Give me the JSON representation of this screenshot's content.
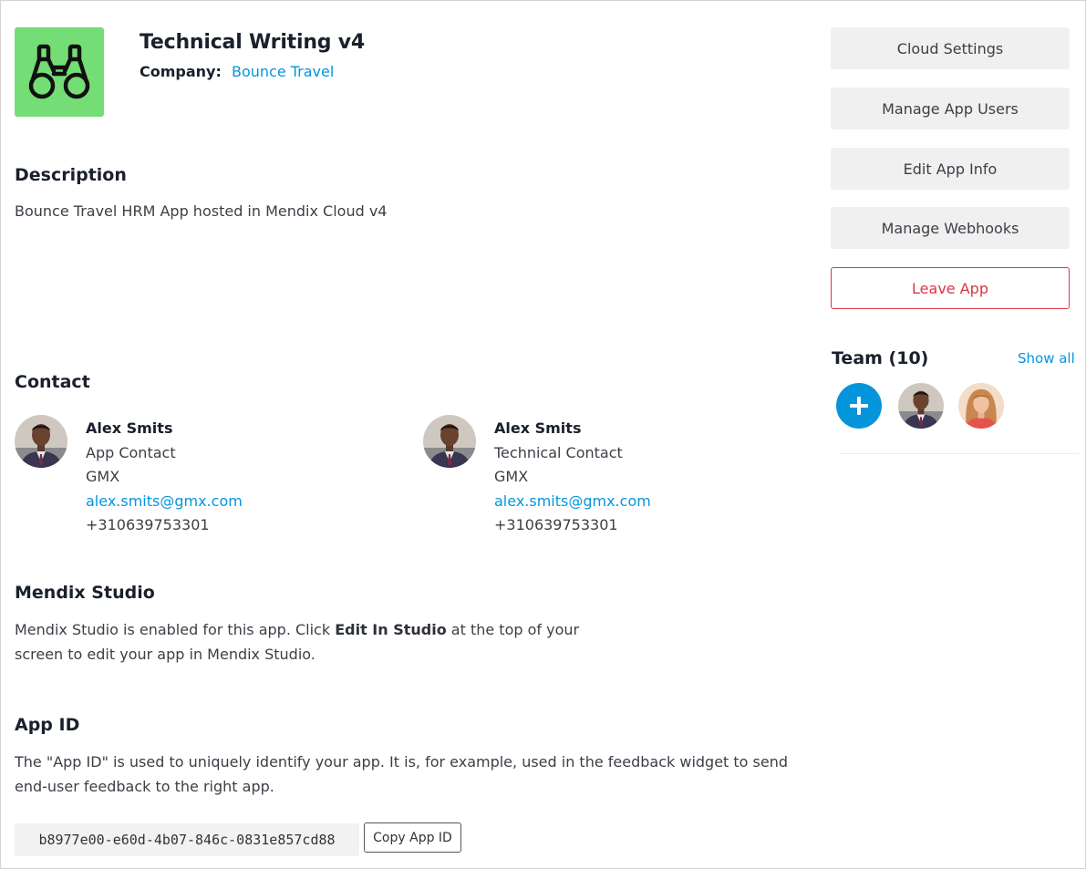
{
  "app": {
    "title": "Technical Writing v4",
    "company_label": "Company:",
    "company_name": "Bounce Travel",
    "logo_icon": "binoculars-icon",
    "logo_color": "#74dd75"
  },
  "description": {
    "title": "Description",
    "text": "Bounce Travel HRM App hosted in Mendix Cloud v4"
  },
  "contact": {
    "title": "Contact",
    "people": [
      {
        "name": "Alex Smits",
        "role": "App Contact",
        "company": "GMX",
        "email": "alex.smits@gmx.com",
        "phone": "+310639753301"
      },
      {
        "name": "Alex Smits",
        "role": "Technical Contact",
        "company": "GMX",
        "email": "alex.smits@gmx.com",
        "phone": "+310639753301"
      }
    ]
  },
  "studio": {
    "title": "Mendix Studio",
    "text_before": "Mendix Studio is enabled for this app. Click ",
    "text_bold": "Edit In Studio",
    "text_after": " at the top of your",
    "text_line2": "screen to edit your app in Mendix Studio."
  },
  "app_id": {
    "title": "App ID",
    "text_line1": "The \"App ID\" is used to uniquely identify your app. It is, for example, used in the feedback widget to send",
    "text_line2": "end-user feedback to the right app.",
    "value": "b8977e00-e60d-4b07-846c-0831e857cd88",
    "copy_label": "Copy App ID"
  },
  "sidebar": {
    "buttons": [
      {
        "label": "Cloud Settings"
      },
      {
        "label": "Manage App Users"
      },
      {
        "label": "Edit App Info"
      },
      {
        "label": "Manage Webhooks"
      },
      {
        "label": "Leave App"
      }
    ],
    "team_title": "Team (10)",
    "show_all": "Show all",
    "add_icon": "plus-icon",
    "accent_color": "#0595db",
    "danger_color": "#dc3545"
  }
}
